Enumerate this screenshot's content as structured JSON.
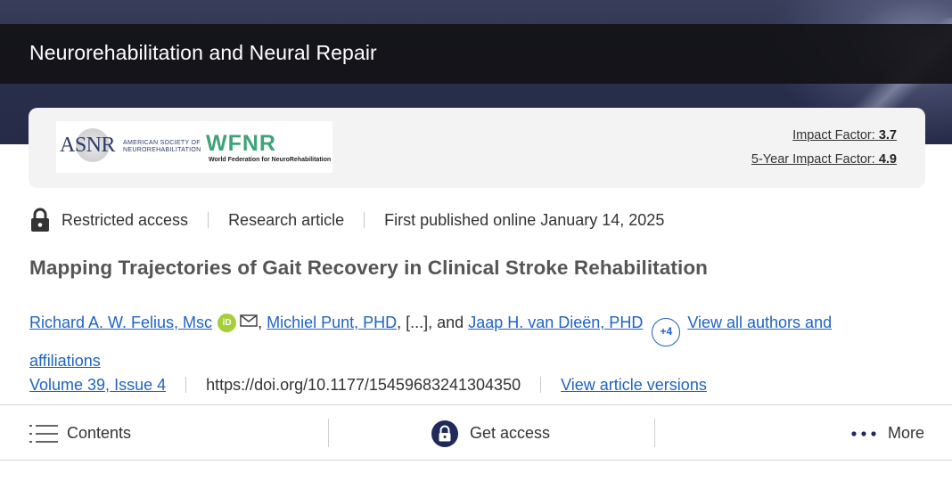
{
  "header": {
    "journal_title": "Neurorehabilitation and Neural Repair"
  },
  "info_card": {
    "logos": {
      "asnr_mark": "ASNR",
      "asnr_sub": "AMERICAN SOCIETY OF NEUROREHABILITATION",
      "wfnr_mark": "WFNR",
      "wfnr_sub": "World Federation for NeuroRehabilitation"
    },
    "impact_factor_label": "Impact Factor:",
    "impact_factor_value": "3.7",
    "five_year_label": "5-Year Impact Factor:",
    "five_year_value": "4.9"
  },
  "meta": {
    "access": "Restricted access",
    "article_type": "Research article",
    "published": "First published online January 14, 2025"
  },
  "article": {
    "title": "Mapping Trajectories of Gait Recovery in Clinical Stroke Rehabilitation"
  },
  "authors": {
    "author1": "Richard A. W. Felius, Msc",
    "orcid_label": "iD",
    "comma1": ",",
    "author2": "Michiel Punt, PHD",
    "ellipsis": ", [...], and",
    "author3": "Jaap H. van Dieën, PHD",
    "more_count": "+4",
    "view_all": "View all authors and affiliations"
  },
  "volume": {
    "issue": "Volume 39, Issue 4",
    "doi": "https://doi.org/10.1177/15459683241304350",
    "versions": "View article versions"
  },
  "actions": {
    "contents": "Contents",
    "get_access": "Get access",
    "more": "More"
  },
  "colors": {
    "link": "#1e63c6",
    "orcid": "#a6ce39",
    "access_icon": "#1f2a5a",
    "wfnr_green": "#3fa37a"
  }
}
